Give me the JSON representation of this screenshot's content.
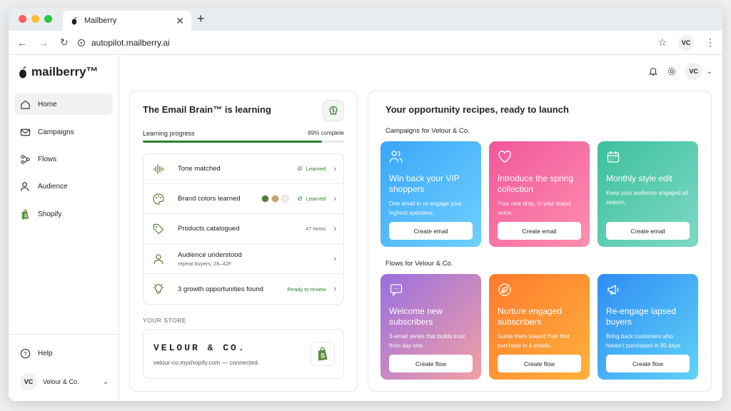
{
  "browser": {
    "tab_title": "Mailberry",
    "url": "autopilot.mailberry.ai",
    "profile_initials": "VC"
  },
  "sidebar": {
    "logo_text": "mailberry™",
    "items": [
      {
        "label": "Home",
        "icon": "home-icon",
        "active": true
      },
      {
        "label": "Campaigns",
        "icon": "mail-icon"
      },
      {
        "label": "Flows",
        "icon": "flows-icon"
      },
      {
        "label": "Audience",
        "icon": "user-icon"
      },
      {
        "label": "Shopify",
        "icon": "shopify-icon"
      }
    ],
    "help_label": "Help",
    "account": {
      "initials": "VC",
      "name": "Velour & Co."
    }
  },
  "header": {
    "user_initials": "VC"
  },
  "brain_card": {
    "title": "The Email Brain™ is learning",
    "progress_label": "Learning progress",
    "progress_text": "89% complete",
    "progress_value": 0.89,
    "rows": [
      {
        "label": "Tone matched",
        "status": "Learned"
      },
      {
        "label": "Brand colors learned",
        "status": "Learned",
        "swatches": [
          "#4f7a3a",
          "#c8a173",
          "#f3efe8"
        ]
      },
      {
        "label": "Products catalogued",
        "status": "47 items"
      },
      {
        "label": "Audience understood",
        "sub": "repeat buyers, 28–42F",
        "status": ""
      },
      {
        "label": "3 growth opportunities found",
        "status": "Ready to review"
      }
    ],
    "store_section_label": "YOUR STORE",
    "store_name": "VELOUR & CO.",
    "store_url": "velour-co.myshopify.com — connected."
  },
  "recipes": {
    "title": "Your opportunity recipes, ready to launch",
    "campaigns_label": "Campaigns for Velour & Co.",
    "flows_label": "Flows for Velour & Co.",
    "campaigns": [
      {
        "title": "Win back your VIP shoppers",
        "desc": "One email to re-engage your highest spenders.",
        "button": "Create email",
        "icon": "users-icon",
        "color_a": "#3aa6f7",
        "color_b": "#6fd0ff"
      },
      {
        "title": "Introduce the spring collection",
        "desc": "Your new drop, in your brand voice.",
        "button": "Create email",
        "icon": "heart-icon",
        "color_a": "#f0579b",
        "color_b": "#ff8fae"
      },
      {
        "title": "Monthly style edit",
        "desc": "Keep your audience engaged all season.",
        "button": "Create email",
        "icon": "calendar-icon",
        "color_a": "#3cc09c",
        "color_b": "#7fd9c4"
      }
    ],
    "flows": [
      {
        "title": "Welcome new subscribers",
        "desc": "3-email series that builds trust from day one.",
        "button": "Create flow",
        "icon": "chat-icon",
        "color_a": "#9a6fe0",
        "color_b": "#f2a0a4"
      },
      {
        "title": "Nurture engaged subscribers",
        "desc": "Guide them toward their first purchase in 4 emails.",
        "button": "Create flow",
        "icon": "leaf-icon",
        "color_a": "#ff7a2e",
        "color_b": "#ffb13b"
      },
      {
        "title": "Re-engage lapsed buyers",
        "desc": "Bring back customers who haven't purchased in 90 days.",
        "button": "Create flow",
        "icon": "megaphone-icon",
        "color_a": "#2f8cf4",
        "color_b": "#5fd2f6"
      }
    ]
  }
}
